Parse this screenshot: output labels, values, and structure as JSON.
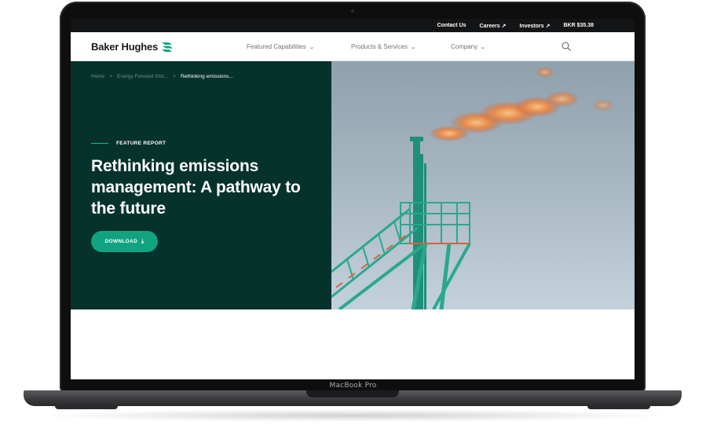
{
  "device": {
    "label": "MacBook Pro"
  },
  "topbar": {
    "links": [
      {
        "label": "Contact Us",
        "arrow": ""
      },
      {
        "label": "Careers",
        "arrow": "↗"
      },
      {
        "label": "Investors",
        "arrow": "↗"
      },
      {
        "label": "BKR $35.38",
        "arrow": ""
      }
    ]
  },
  "nav": {
    "logo_text": "Baker Hughes",
    "items": [
      {
        "label": "Featured Capabilities"
      },
      {
        "label": "Products & Services"
      },
      {
        "label": "Company"
      }
    ],
    "chevron": "⌄"
  },
  "hero": {
    "breadcrumb": [
      "Home",
      "Energy Forward Stor...",
      "Rethinking emissions..."
    ],
    "breadcrumb_sep": ">",
    "eyebrow": "FEATURE REPORT",
    "headline": "Rethinking emissions management: A pathway to the future",
    "download_label": "DOWNLOAD",
    "download_icon": "⤓"
  },
  "colors": {
    "hero_bg": "#05322b",
    "accent": "#11a37f",
    "topbar_bg": "#131416"
  }
}
